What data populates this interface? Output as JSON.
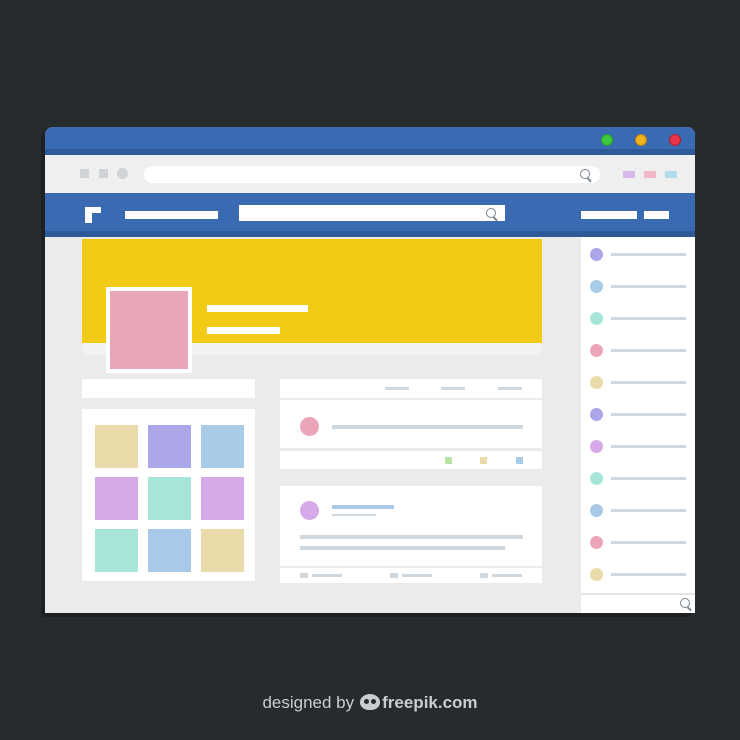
{
  "colors": {
    "background": "#262b2e",
    "window_chrome": "#3a6bb2",
    "cover": "#f1cb16",
    "avatar": "#e9a6b8",
    "traffic_green": "#3cc93c",
    "traffic_yellow": "#f0b31c",
    "traffic_red": "#e8334a"
  },
  "window": {
    "traffic_lights": [
      "green-dot-icon",
      "yellow-dot-icon",
      "red-dot-icon"
    ],
    "toolbar_swatches": [
      "#d7b9e9",
      "#f1b8c8",
      "#b3dcea"
    ]
  },
  "gallery": {
    "tiles": [
      "#e9dcaa",
      "#aba6e8",
      "#a8cbe8",
      "#d6a9e8",
      "#a8e5d9",
      "#d6a9e8",
      "#a8e5d9",
      "#a8c9e8",
      "#e9dcaa"
    ]
  },
  "post1": {
    "avatar_color": "#eaa6b8",
    "reactions": [
      "#b9e3a5",
      "#e9dcaa",
      "#a8cbe8"
    ]
  },
  "post2": {
    "avatar_color": "#d6a9e8"
  },
  "sidebar": {
    "dots": [
      "#aba6e8",
      "#a8cbe8",
      "#a8e5d9",
      "#eaa6b8",
      "#e9dcaa",
      "#aba6e8",
      "#d6a9e8",
      "#a8e5d9",
      "#a8c9e8",
      "#eaa6b8",
      "#e9dcaa"
    ]
  },
  "credit": {
    "prefix": "designed by",
    "brand": "freepik.com"
  }
}
